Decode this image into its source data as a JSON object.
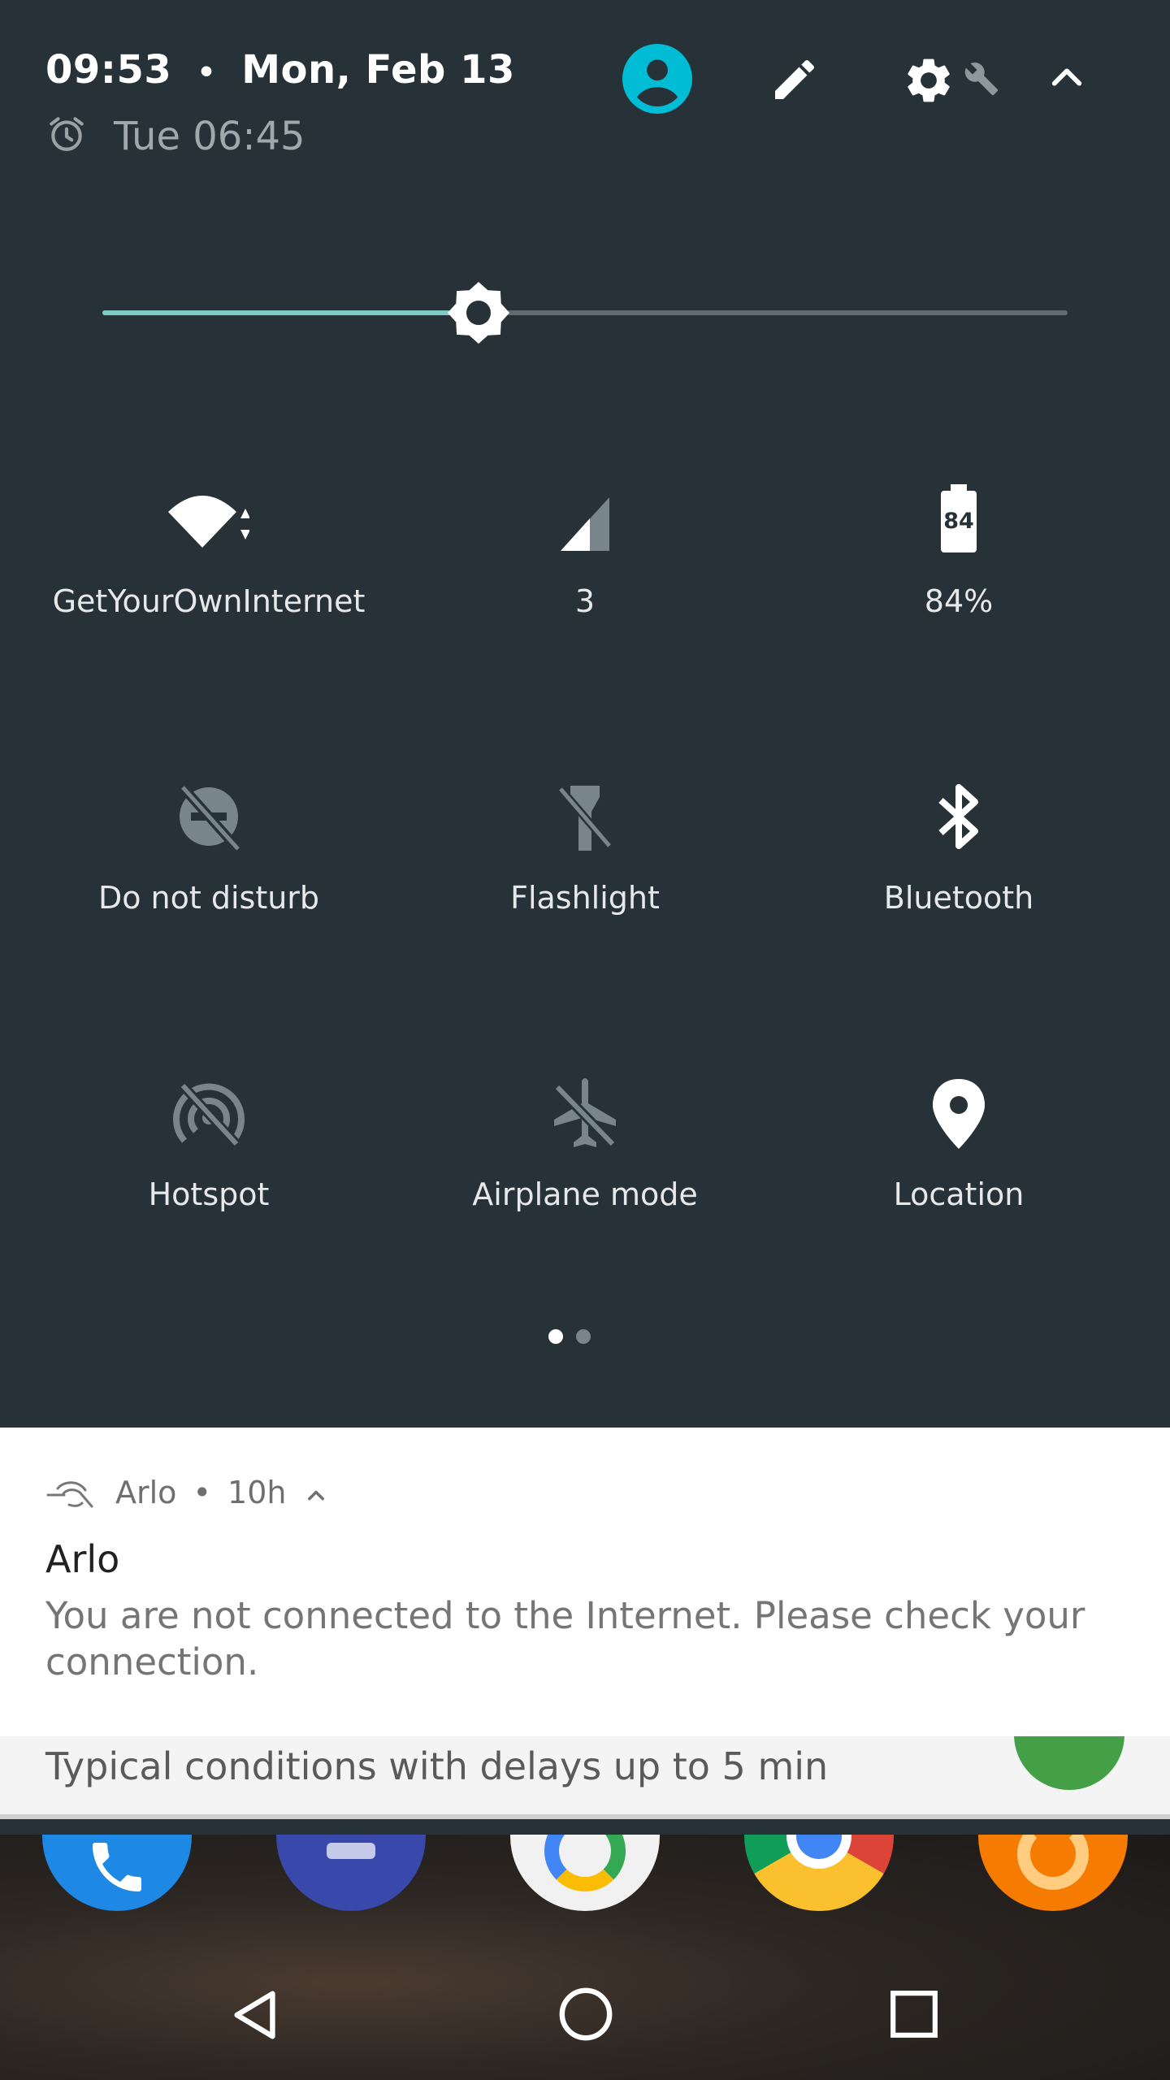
{
  "status_header": {
    "time": "09:53",
    "separator": "•",
    "date": "Mon, Feb 13",
    "alarm": "Tue 06:45"
  },
  "header_actions": {
    "user_icon": "account-circle-icon",
    "edit_icon": "pencil-icon",
    "settings_icon": "gear-wrench-icon",
    "collapse_icon": "chevron-up-icon"
  },
  "brightness": {
    "level": 0.39
  },
  "tiles": [
    {
      "label": "GetYourOwnInternet",
      "icon": "wifi-icon",
      "active": true
    },
    {
      "label": "3",
      "icon": "signal-icon",
      "active": true
    },
    {
      "label": "84%",
      "icon": "battery-icon",
      "active": true,
      "battery_text": "84"
    },
    {
      "label": "Do not disturb",
      "icon": "do-not-disturb-off-icon",
      "active": false
    },
    {
      "label": "Flashlight",
      "icon": "flashlight-off-icon",
      "active": false
    },
    {
      "label": "Bluetooth",
      "icon": "bluetooth-icon",
      "active": true
    },
    {
      "label": "Hotspot",
      "icon": "hotspot-off-icon",
      "active": false
    },
    {
      "label": "Airplane mode",
      "icon": "airplane-off-icon",
      "active": false
    },
    {
      "label": "Location",
      "icon": "location-pin-icon",
      "active": true
    }
  ],
  "page_indicator": {
    "current": 1,
    "total": 2
  },
  "notification": {
    "app_name": "Arlo",
    "dot": "•",
    "age": "10h",
    "title": "Arlo",
    "body": "You are not connected to the Internet. Please check your connection."
  },
  "second_card": {
    "text": "Typical conditions with delays up to 5 min"
  },
  "colors": {
    "panel_bg": "#263238",
    "accent": "#80cbc4",
    "user_icon": "#00bcd4",
    "inactive_icon": "#78858b",
    "active_icon": "#ffffff"
  },
  "navigation": {
    "back_icon": "back-triangle-icon",
    "home_icon": "home-circle-icon",
    "recents_icon": "recents-square-icon"
  }
}
